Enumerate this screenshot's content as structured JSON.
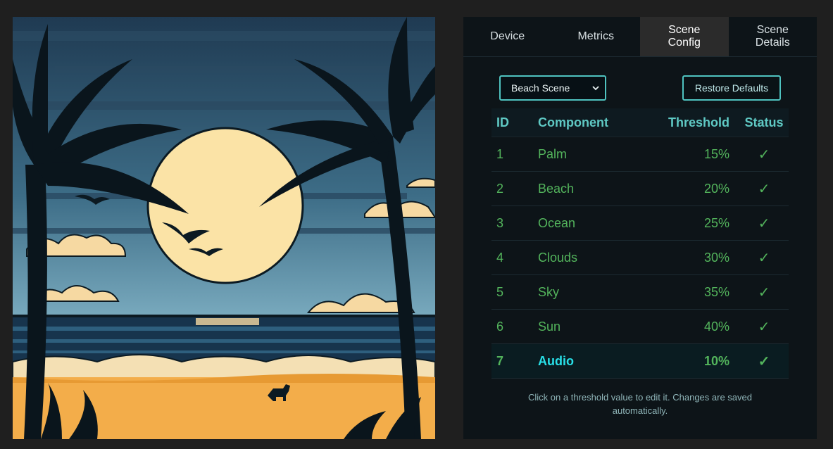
{
  "tabs": [
    {
      "label": "Device"
    },
    {
      "label": "Metrics"
    },
    {
      "label": "Scene\nConfig",
      "active": true
    },
    {
      "label": "Scene\nDetails"
    }
  ],
  "scene_select": {
    "selected": "Beach Scene"
  },
  "restore_button": {
    "label": "Restore Defaults"
  },
  "table": {
    "headers": {
      "id": "ID",
      "component": "Component",
      "threshold": "Threshold",
      "status": "Status"
    },
    "rows": [
      {
        "id": "1",
        "component": "Palm",
        "threshold": "15%",
        "status": "✓"
      },
      {
        "id": "2",
        "component": "Beach",
        "threshold": "20%",
        "status": "✓"
      },
      {
        "id": "3",
        "component": "Ocean",
        "threshold": "25%",
        "status": "✓"
      },
      {
        "id": "4",
        "component": "Clouds",
        "threshold": "30%",
        "status": "✓"
      },
      {
        "id": "5",
        "component": "Sky",
        "threshold": "35%",
        "status": "✓"
      },
      {
        "id": "6",
        "component": "Sun",
        "threshold": "40%",
        "status": "✓"
      },
      {
        "id": "7",
        "component": "Audio",
        "threshold": "10%",
        "status": "✓"
      }
    ]
  },
  "hint": "Click on a threshold value to edit it. Changes are saved automatically.",
  "colors": {
    "accent": "#4fc3c0",
    "row_text": "#53b45c",
    "highlight_component": "#28e0e8",
    "panel_bg": "#0d1418"
  }
}
